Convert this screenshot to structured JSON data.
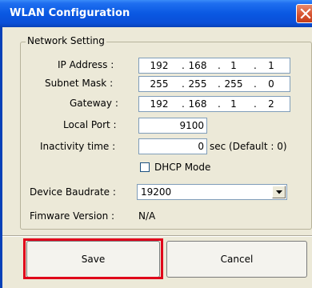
{
  "window": {
    "title": "WLAN Configuration"
  },
  "group": {
    "title": "Network Setting"
  },
  "fields": {
    "ip_label": "IP Address :",
    "ip_octets": [
      "192",
      "168",
      "1",
      "1"
    ],
    "subnet_label": "Subnet Mask :",
    "subnet_octets": [
      "255",
      "255",
      "255",
      "0"
    ],
    "gateway_label": "Gateway :",
    "gateway_octets": [
      "192",
      "168",
      "1",
      "2"
    ],
    "dot": ".",
    "local_port_label": "Local Port :",
    "local_port_value": "9100",
    "inactivity_label": "Inactivity time :",
    "inactivity_value": "0",
    "inactivity_suffix": "sec (Default : 0)",
    "dhcp_label": "DHCP Mode",
    "dhcp_checked": false,
    "baudrate_label": "Device Baudrate :",
    "baudrate_value": "19200",
    "firmware_label": "Fimware Version :",
    "firmware_value": "N/A"
  },
  "buttons": {
    "save": "Save",
    "cancel": "Cancel"
  },
  "colors": {
    "titlebar": "#0a58e2",
    "highlight": "#e0001a",
    "close": "#d6502d"
  }
}
